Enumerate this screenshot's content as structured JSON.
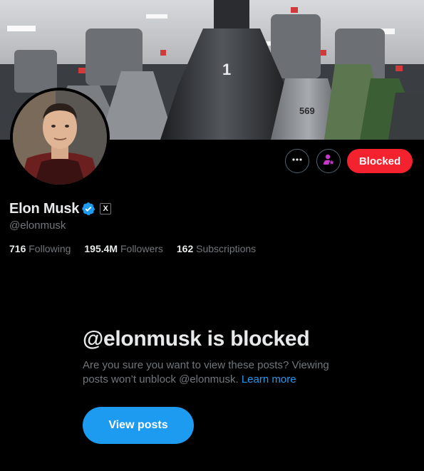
{
  "banner": {
    "engine_number_1": "1",
    "engine_number_2": "569"
  },
  "actions": {
    "more_icon": "more-horizontal-icon",
    "subscribe_icon": "subscribe-star-person-icon",
    "blocked_label": "Blocked"
  },
  "profile": {
    "name": "Elon Musk",
    "handle": "@elonmusk",
    "affiliation_badge": "X",
    "following_count": "716",
    "following_label": "Following",
    "followers_count": "195.4M",
    "followers_label": "Followers",
    "subscriptions_count": "162",
    "subscriptions_label": "Subscriptions"
  },
  "blocked": {
    "title": "@elonmusk is blocked",
    "description": "Are you sure you want to view these posts? Viewing posts won’t unblock @elonmusk.",
    "learn_more": "Learn more",
    "view_posts_label": "View posts"
  },
  "colors": {
    "accent": "#1d9bf0",
    "blocked_red": "#f4212e",
    "subscribe_purple": "#c936cc",
    "muted": "#71767b",
    "text": "#e7e9ea"
  }
}
